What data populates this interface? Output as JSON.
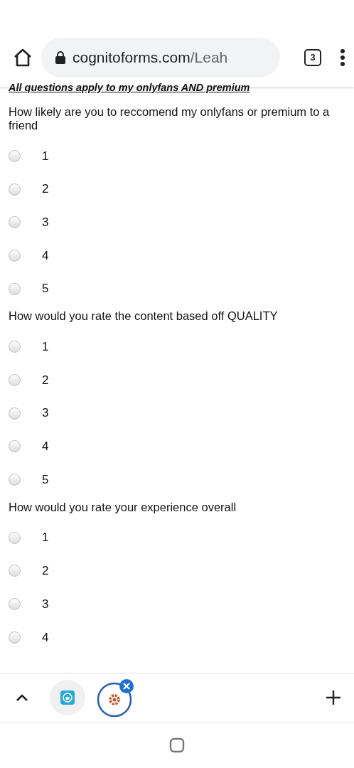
{
  "browser": {
    "url_host": "cognitoforms.com",
    "url_path": "/Leah",
    "tab_count": "3"
  },
  "form": {
    "heading": "All questions apply to my onlyfans AND premium",
    "questions": [
      {
        "text": "How likely are you to reccomend my onlyfans or premium to a friend",
        "options": [
          {
            "label": "1",
            "selected": false
          },
          {
            "label": "2",
            "selected": false
          },
          {
            "label": "3",
            "selected": false
          },
          {
            "label": "4",
            "selected": false
          },
          {
            "label": "5",
            "selected": false
          }
        ]
      },
      {
        "text": "How would you rate the content based off QUALITY",
        "options": [
          {
            "label": "1",
            "selected": false
          },
          {
            "label": "2",
            "selected": false
          },
          {
            "label": "3",
            "selected": false
          },
          {
            "label": "4",
            "selected": false
          },
          {
            "label": "5",
            "selected": false
          }
        ]
      },
      {
        "text": "How would you rate your experience overall",
        "options": [
          {
            "label": "1",
            "selected": false
          },
          {
            "label": "2",
            "selected": false
          },
          {
            "label": "3",
            "selected": false
          },
          {
            "label": "4",
            "selected": false
          }
        ]
      }
    ]
  }
}
